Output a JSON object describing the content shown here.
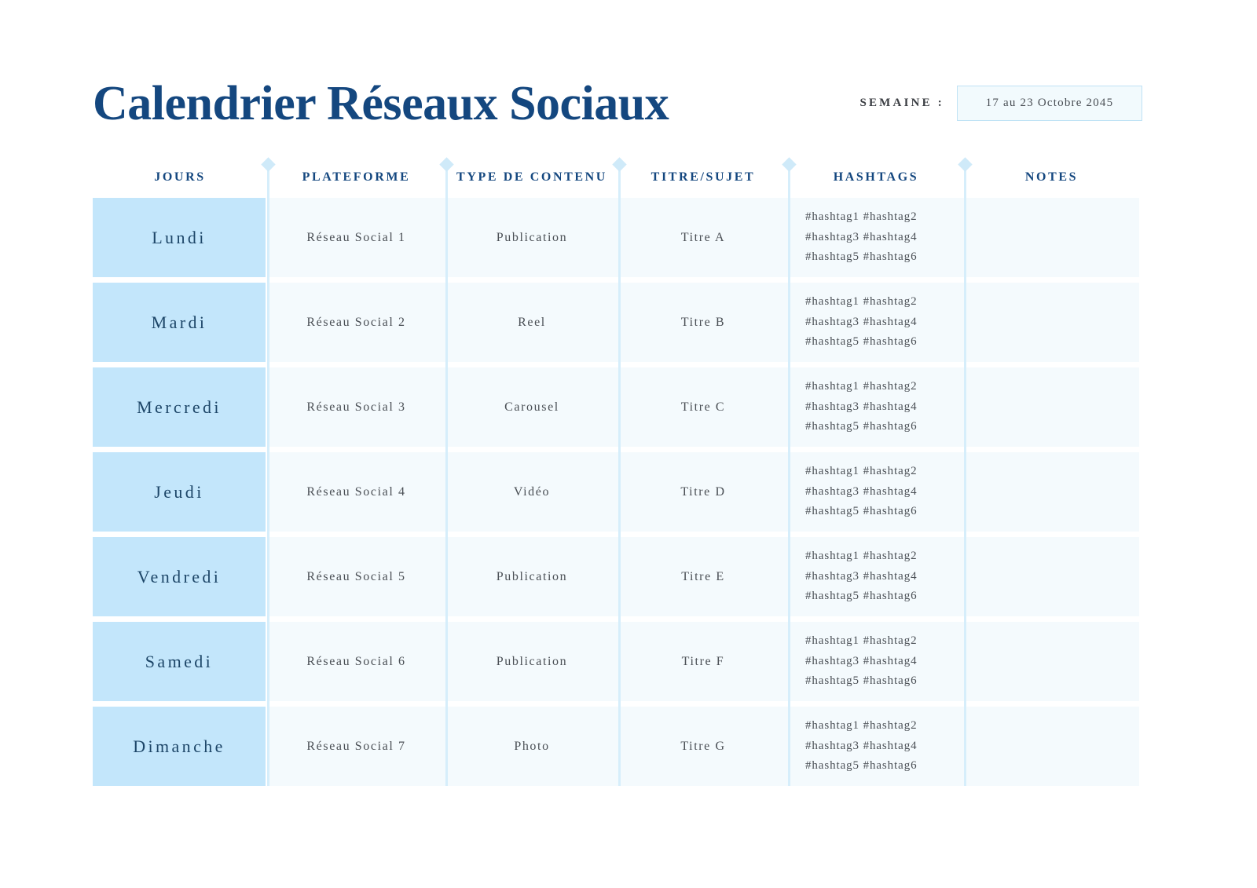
{
  "header": {
    "title": "Calendrier Réseaux Sociaux",
    "week_label": "SEMAINE :",
    "week_value": "17 au 23 Octobre 2045"
  },
  "table": {
    "columns": [
      "JOURS",
      "PLATEFORME",
      "TYPE DE CONTENU",
      "TITRE/SUJET",
      "HASHTAGS",
      "NOTES"
    ],
    "rows": [
      {
        "day": "Lundi",
        "platform": "Réseau Social 1",
        "content_type": "Publication",
        "title": "Titre A",
        "hashtags": [
          "#hashtag1 #hashtag2",
          "#hashtag3 #hashtag4",
          "#hashtag5 #hashtag6"
        ],
        "notes": ""
      },
      {
        "day": "Mardi",
        "platform": "Réseau Social 2",
        "content_type": "Reel",
        "title": "Titre B",
        "hashtags": [
          "#hashtag1 #hashtag2",
          "#hashtag3 #hashtag4",
          "#hashtag5 #hashtag6"
        ],
        "notes": ""
      },
      {
        "day": "Mercredi",
        "platform": "Réseau Social 3",
        "content_type": "Carousel",
        "title": "Titre C",
        "hashtags": [
          "#hashtag1 #hashtag2",
          "#hashtag3 #hashtag4",
          "#hashtag5 #hashtag6"
        ],
        "notes": ""
      },
      {
        "day": "Jeudi",
        "platform": "Réseau Social 4",
        "content_type": "Vidéo",
        "title": "Titre D",
        "hashtags": [
          "#hashtag1 #hashtag2",
          "#hashtag3 #hashtag4",
          "#hashtag5 #hashtag6"
        ],
        "notes": ""
      },
      {
        "day": "Vendredi",
        "platform": "Réseau Social 5",
        "content_type": "Publication",
        "title": "Titre E",
        "hashtags": [
          "#hashtag1 #hashtag2",
          "#hashtag3 #hashtag4",
          "#hashtag5 #hashtag6"
        ],
        "notes": ""
      },
      {
        "day": "Samedi",
        "platform": "Réseau Social 6",
        "content_type": "Publication",
        "title": "Titre F",
        "hashtags": [
          "#hashtag1 #hashtag2",
          "#hashtag3 #hashtag4",
          "#hashtag5 #hashtag6"
        ],
        "notes": ""
      },
      {
        "day": "Dimanche",
        "platform": "Réseau Social 7",
        "content_type": "Photo",
        "title": "Titre G",
        "hashtags": [
          "#hashtag1 #hashtag2",
          "#hashtag3 #hashtag4",
          "#hashtag5 #hashtag6"
        ],
        "notes": ""
      }
    ]
  },
  "colors": {
    "title_navy": "#14477f",
    "day_cell_blue": "#c3e6fb",
    "cell_pale": "#f4fafd",
    "divider_blue": "#d6eefb",
    "box_border": "#bfe2f5",
    "body_text": "#4a4f55"
  }
}
